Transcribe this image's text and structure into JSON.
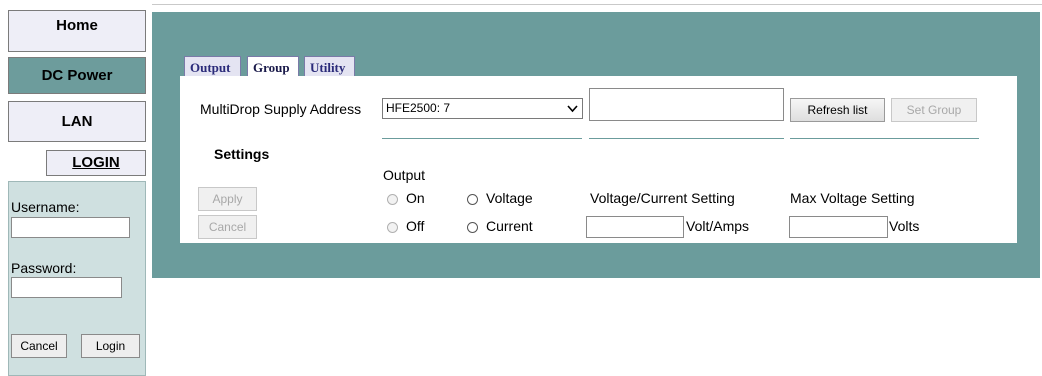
{
  "nav": {
    "home": "Home",
    "dc_power": "DC Power",
    "lan": "LAN",
    "login": "LOGIN"
  },
  "login_panel": {
    "username_label": "Username:",
    "username_value": "",
    "password_label": "Password:",
    "password_value": "",
    "cancel_label": "Cancel",
    "login_label": "Login"
  },
  "tabs": [
    {
      "label": "Output",
      "active": false
    },
    {
      "label": "Group",
      "active": true
    },
    {
      "label": "Utility",
      "active": false
    }
  ],
  "group": {
    "supply_address_label": "MultiDrop Supply Address",
    "supply_address_selected": "HFE2500: 7",
    "address_field_value": "",
    "refresh_label": "Refresh list",
    "set_group_label": "Set Group",
    "settings_heading": "Settings",
    "output_heading": "Output",
    "apply_label": "Apply",
    "cancel_label": "Cancel",
    "on_label": "On",
    "off_label": "Off",
    "voltage_label": "Voltage",
    "current_label": "Current",
    "vc_setting_label": "Voltage/Current Setting",
    "vc_value": "",
    "vc_unit": "Volt/Amps",
    "max_voltage_label": "Max Voltage Setting",
    "max_voltage_value": "",
    "max_voltage_unit": "Volts"
  },
  "colors": {
    "panel": "#6b9c9c",
    "nav_active": "#6d9c9c",
    "nav_inactive": "#eeeef7",
    "tab_text": "#2b2b7a"
  }
}
